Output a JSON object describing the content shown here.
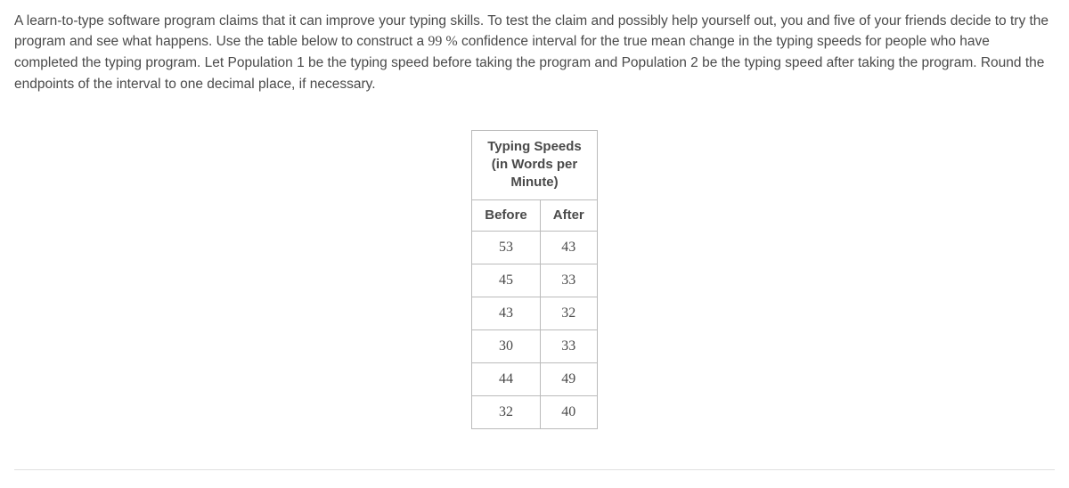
{
  "question": {
    "text_before_ci": "A learn-to-type software program claims that it can improve your typing skills. To test the claim and possibly help yourself out, you and five of your friends decide to try the program and see what happens. Use the table below to construct a ",
    "confidence_level": "99 %",
    "text_after_ci": " confidence interval for the true mean change in the typing speeds for people who have completed the typing program. Let Population 1 be the typing speed before taking the program and Population 2 be the typing speed after taking the program. Round the endpoints of the interval to one decimal place, if necessary."
  },
  "table": {
    "caption_line1": "Typing Speeds",
    "caption_line2": "(in Words per",
    "caption_line3": "Minute)",
    "headers": {
      "col1": "Before",
      "col2": "After"
    },
    "rows": [
      {
        "before": "53",
        "after": "43"
      },
      {
        "before": "45",
        "after": "33"
      },
      {
        "before": "43",
        "after": "32"
      },
      {
        "before": "30",
        "after": "33"
      },
      {
        "before": "44",
        "after": "49"
      },
      {
        "before": "32",
        "after": "40"
      }
    ]
  }
}
